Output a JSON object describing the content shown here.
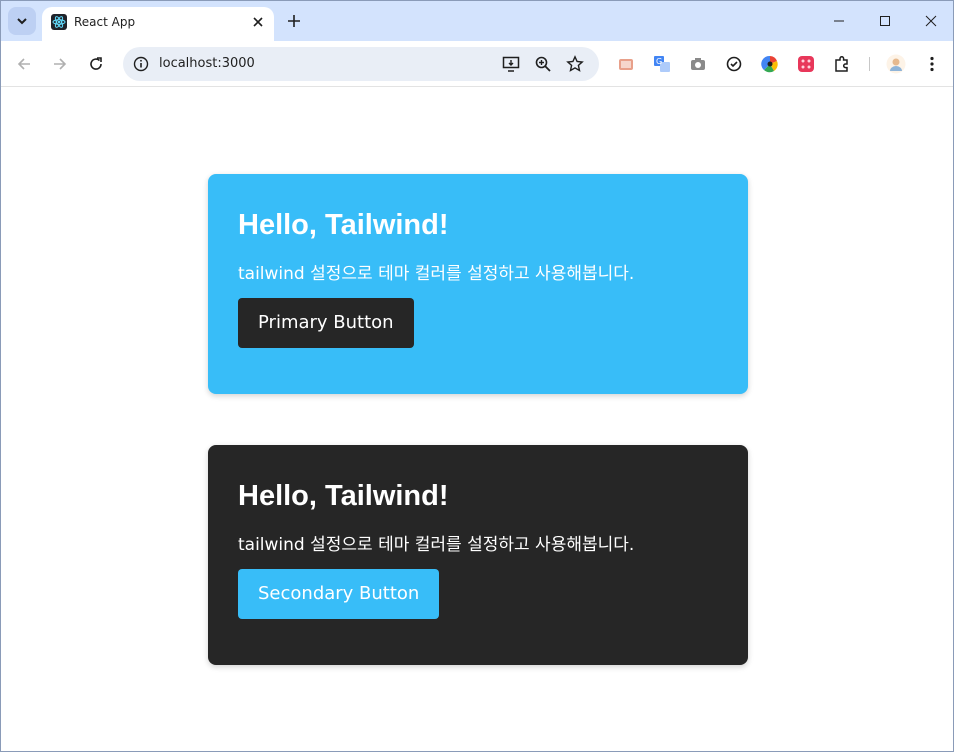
{
  "browser": {
    "tab": {
      "title": "React App"
    },
    "url": "localhost:3000"
  },
  "cards": [
    {
      "title": "Hello, Tailwind!",
      "text": "tailwind 설정으로 테마 컬러를 설정하고 사용해봅니다.",
      "button_label": "Primary Button"
    },
    {
      "title": "Hello, Tailwind!",
      "text": "tailwind 설정으로 테마 컬러를 설정하고 사용해봅니다.",
      "button_label": "Secondary Button"
    }
  ],
  "colors": {
    "primary": "#38bdf8",
    "secondary": "#262626",
    "tabstrip": "#d3e3fd"
  }
}
